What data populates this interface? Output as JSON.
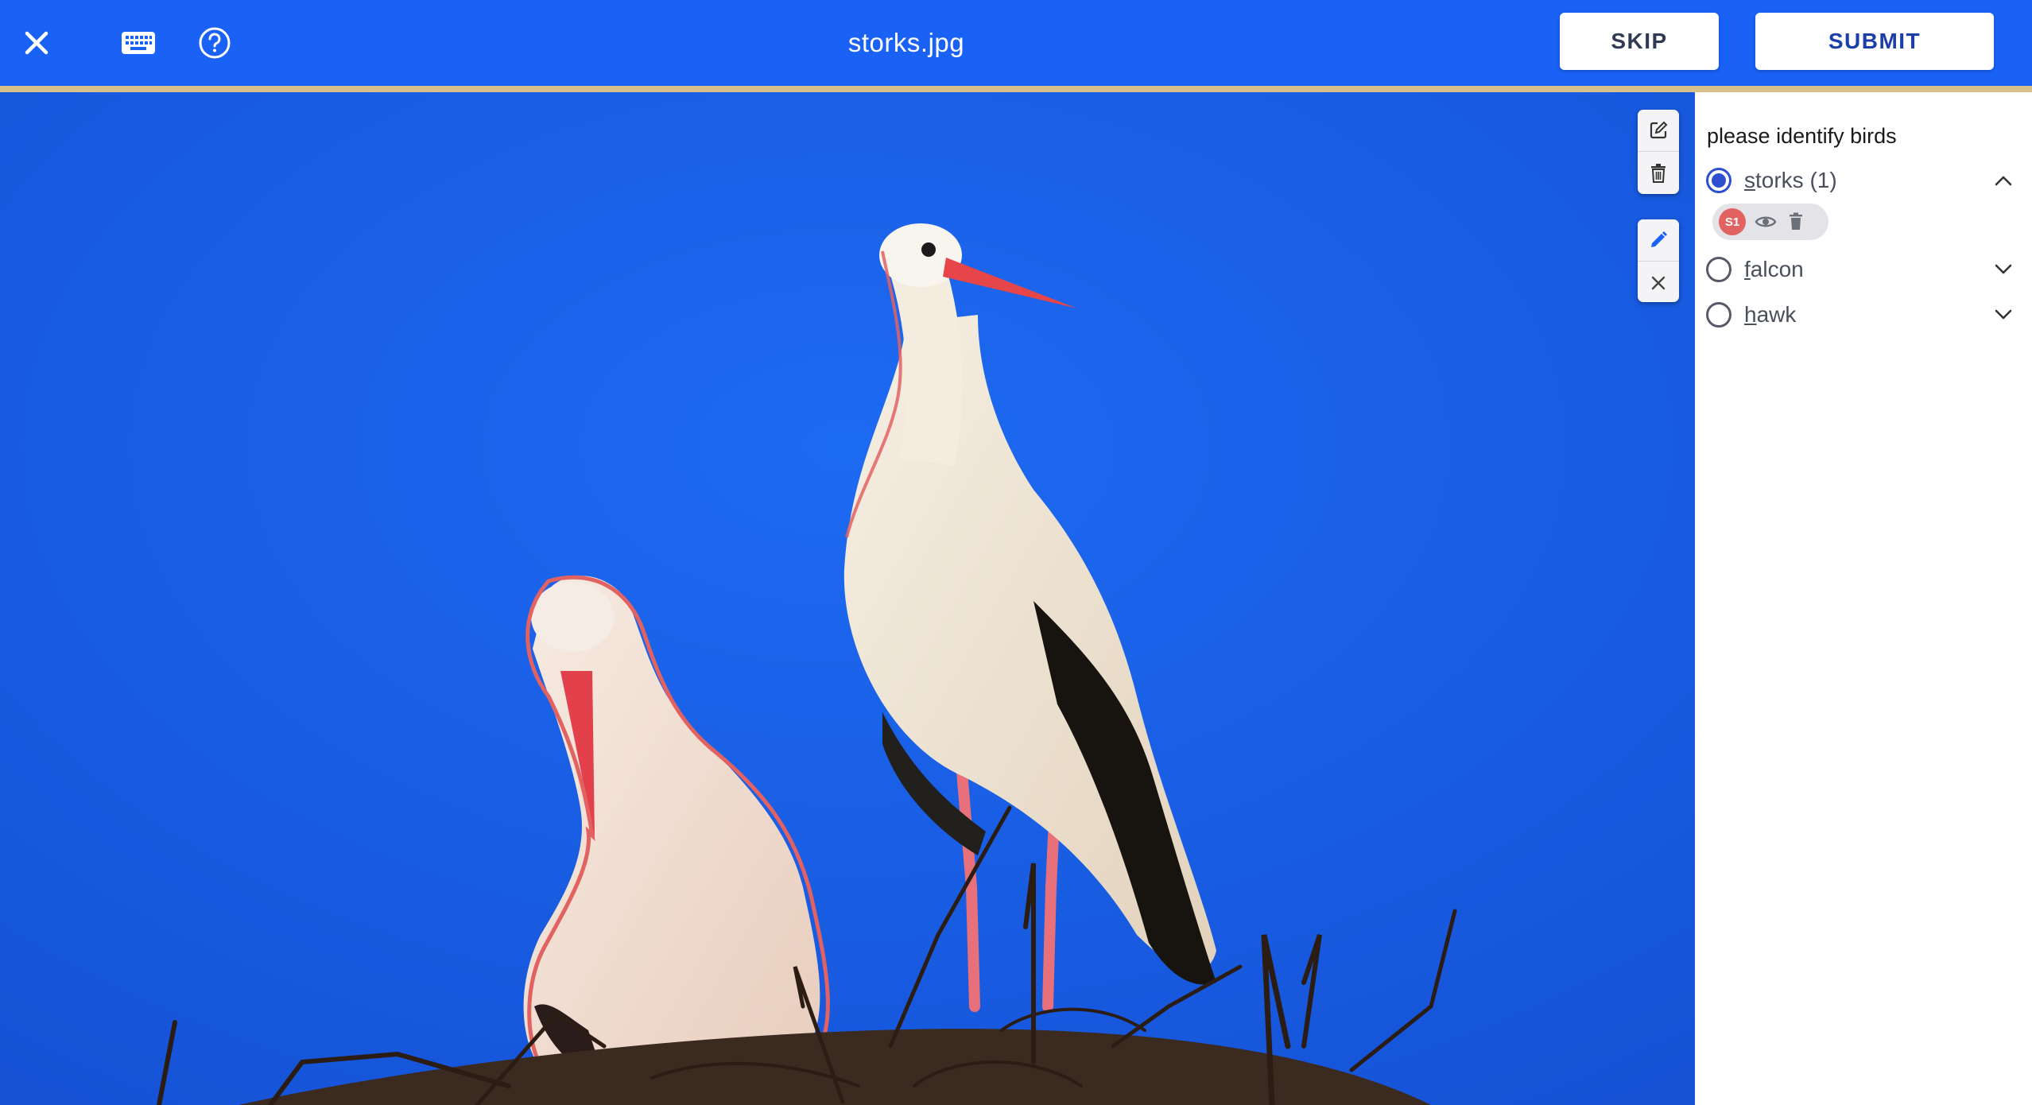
{
  "header": {
    "file_name": "storks.jpg",
    "close_icon": "close-icon",
    "keyboard_icon": "keyboard-icon",
    "help_icon": "help-circle-icon",
    "skip_label": "SKIP",
    "submit_label": "SUBMIT"
  },
  "toolbar": {
    "group1": [
      "edit-square-icon",
      "trash-icon"
    ],
    "group2": [
      "pencil-icon",
      "close-icon"
    ]
  },
  "panel": {
    "question": "please identify birds",
    "options": [
      {
        "label_first": "s",
        "label_rest": "torks (1)",
        "checked": true,
        "expanded": true
      },
      {
        "label_first": "f",
        "label_rest": "alcon",
        "checked": false,
        "expanded": false
      },
      {
        "label_first": "h",
        "label_rest": "awk",
        "checked": false,
        "expanded": false
      }
    ],
    "instance": {
      "badge": "S1",
      "badge_color": "#e26161",
      "icons": [
        "eye-icon",
        "trash-icon"
      ]
    }
  },
  "colors": {
    "primary": "#1a61f5",
    "accent_strip": "#d8c08c",
    "sky": "#1f63e6",
    "annotation": "#e26161",
    "selected_radio": "#2d4fd0"
  }
}
